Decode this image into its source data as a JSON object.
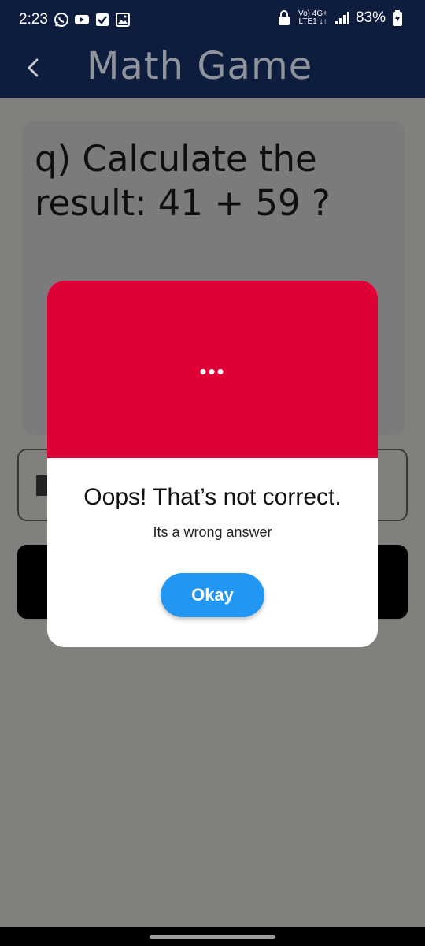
{
  "status_bar": {
    "time": "2:23",
    "network_top": "Vo) 4G+",
    "network_bottom": "LTE1 ↓↑",
    "battery": "83%",
    "icons": [
      "whatsapp-icon",
      "youtube-icon",
      "checkbox-icon",
      "gallery-icon",
      "lock-icon",
      "signal-icon",
      "battery-icon"
    ]
  },
  "appbar": {
    "title": "Math Game",
    "back_icon": "chevron-left-icon"
  },
  "question": {
    "text": "q) Calculate the result: 41 + 59 ?"
  },
  "dialog": {
    "header_color": "#df0037",
    "dots": "•••",
    "title": "Oops! That’s not correct.",
    "message": "Its a wrong answer",
    "button_label": "Okay",
    "button_color": "#2196f3"
  },
  "colors": {
    "appbar_bg": "#0e1c3d",
    "content_bg": "#f7f5ef"
  }
}
